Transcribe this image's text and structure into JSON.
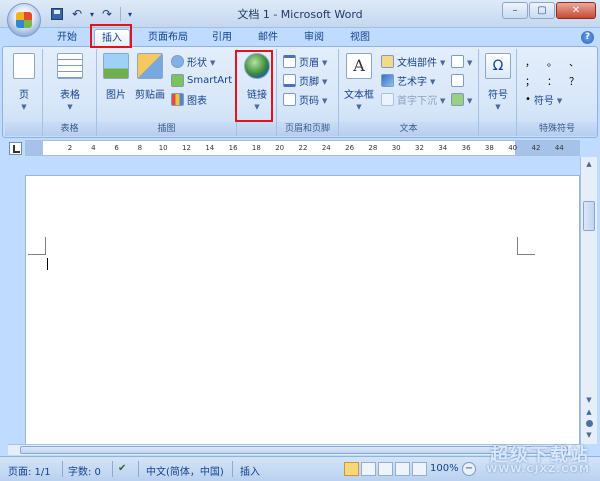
{
  "window": {
    "title": "文档 1 - Microsoft Word",
    "minimize": "–",
    "maximize": "▢",
    "close": "✕"
  },
  "qat": {
    "undo": "↶",
    "redo": "↷",
    "dropdown": "▾"
  },
  "tabs": [
    "开始",
    "插入",
    "页面布局",
    "引用",
    "邮件",
    "审阅",
    "视图"
  ],
  "active_tab": "插入",
  "help": "?",
  "ribbon": {
    "groups": {
      "pages": {
        "label": "",
        "page_btn": "页"
      },
      "tables": {
        "label": "表格",
        "table_btn": "表格"
      },
      "illustrations": {
        "label": "插图",
        "picture": "图片",
        "clipart": "剪贴画",
        "shapes": "形状",
        "smartart": "SmartArt",
        "chart": "图表"
      },
      "links": {
        "label": "",
        "link_btn": "链接"
      },
      "header_footer": {
        "label": "页眉和页脚",
        "header": "页眉",
        "footer": "页脚",
        "page_number": "页码"
      },
      "text": {
        "label": "文本",
        "textbox": "文本框",
        "quick_parts": "文档部件",
        "wordart": "艺术字",
        "dropcap": "首字下沉"
      },
      "symbols": {
        "label": "",
        "symbol": "符号",
        "omega": "Ω"
      },
      "special": {
        "label": "特殊符号",
        "symbol": "符号",
        "chars": [
          "，",
          "。",
          "、",
          "；",
          "：",
          "？"
        ]
      }
    }
  },
  "ruler": {
    "numbers": [
      "2",
      "4",
      "6",
      "8",
      "10",
      "12",
      "14",
      "16",
      "18",
      "20",
      "22",
      "24",
      "26",
      "28",
      "30",
      "32",
      "34",
      "36",
      "38",
      "40",
      "42",
      "44"
    ]
  },
  "status": {
    "page": "页面: 1/1",
    "words": "字数: 0",
    "language": "中文(简体，中国)",
    "mode": "插入",
    "zoom": "100%"
  },
  "watermark": {
    "line1": "超级下载站",
    "line2": "WWW.CJXZ.COM"
  }
}
